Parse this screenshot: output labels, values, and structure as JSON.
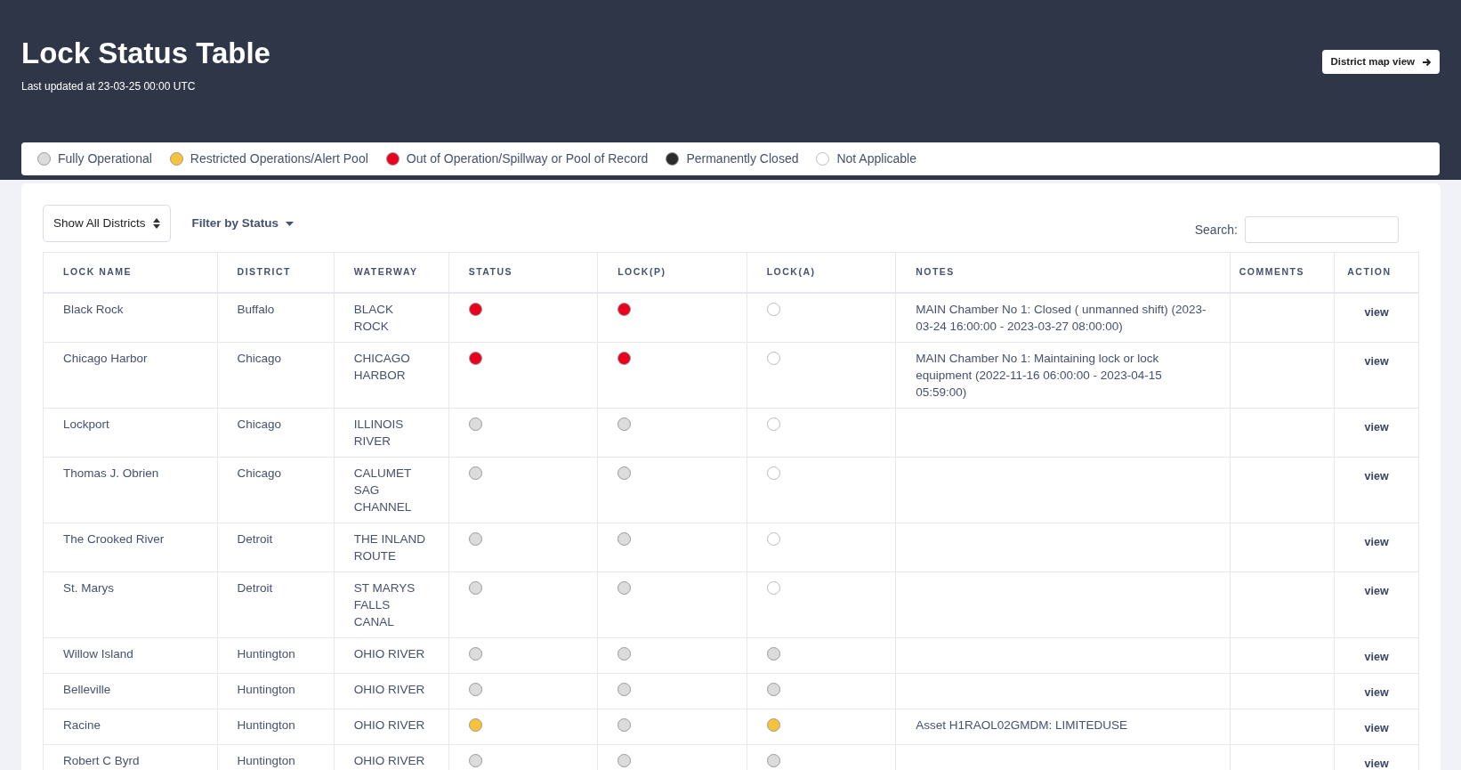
{
  "header": {
    "title": "Lock Status Table",
    "updated": "Last updated at 23-03-25 00:00 UTC",
    "map_button": "District map view"
  },
  "legend": [
    {
      "kind": "operational",
      "label": "Fully Operational",
      "color": "#dcdcdc"
    },
    {
      "kind": "restricted",
      "label": "Restricted Operations/Alert Pool",
      "color": "#f6c33a"
    },
    {
      "kind": "out",
      "label": "Out of Operation/Spillway or Pool of Record",
      "color": "#e8001c"
    },
    {
      "kind": "closed",
      "label": "Permanently Closed",
      "color": "#2b2b2b"
    },
    {
      "kind": "na",
      "label": "Not Applicable",
      "color": "#ffffff"
    }
  ],
  "controls": {
    "district_select": "Show All Districts",
    "status_filter": "Filter by Status",
    "search_label": "Search:"
  },
  "table": {
    "columns": [
      "LOCK NAME",
      "DISTRICT",
      "WATERWAY",
      "STATUS",
      "LOCK(P)",
      "LOCK(A)",
      "NOTES",
      "COMMENTS",
      "ACTION"
    ],
    "rows": [
      {
        "lock_name": "Black Rock",
        "district": "Buffalo",
        "waterway": "BLACK ROCK",
        "status": {
          "color": "#e8001c"
        },
        "lock_p": {
          "color": "#e8001c"
        },
        "lock_a": {
          "color": "#ffffff"
        },
        "notes": "MAIN Chamber No 1: Closed ( unmanned shift) (2023-03-24 16:00:00 - 2023-03-27 08:00:00)",
        "action": "view"
      },
      {
        "lock_name": "Chicago Harbor",
        "district": "Chicago",
        "waterway": "CHICAGO HARBOR",
        "status": {
          "color": "#e8001c"
        },
        "lock_p": {
          "color": "#e8001c"
        },
        "lock_a": {
          "color": "#ffffff"
        },
        "notes": "MAIN Chamber No 1: Maintaining lock or lock equipment (2022-11-16 06:00:00 - 2023-04-15 05:59:00)",
        "action": "view"
      },
      {
        "lock_name": "Lockport",
        "district": "Chicago",
        "waterway": "ILLINOIS RIVER",
        "status": {
          "color": "#dcdcdc"
        },
        "lock_p": {
          "color": "#dcdcdc"
        },
        "lock_a": {
          "color": "#ffffff"
        },
        "action": "view"
      },
      {
        "lock_name": "Thomas J. Obrien",
        "district": "Chicago",
        "waterway": "CALUMET SAG CHANNEL",
        "status": {
          "color": "#dcdcdc"
        },
        "lock_p": {
          "color": "#dcdcdc"
        },
        "lock_a": {
          "color": "#ffffff"
        },
        "action": "view"
      },
      {
        "lock_name": "The Crooked River",
        "district": "Detroit",
        "waterway": "THE INLAND ROUTE",
        "status": {
          "color": "#dcdcdc"
        },
        "lock_p": {
          "color": "#dcdcdc"
        },
        "lock_a": {
          "color": "#ffffff"
        },
        "action": "view"
      },
      {
        "lock_name": "St. Marys",
        "district": "Detroit",
        "waterway": "ST MARYS FALLS CANAL",
        "status": {
          "color": "#dcdcdc"
        },
        "lock_p": {
          "color": "#dcdcdc"
        },
        "lock_a": {
          "color": "#ffffff"
        },
        "action": "view"
      },
      {
        "lock_name": "Willow Island",
        "district": "Huntington",
        "waterway": "OHIO RIVER",
        "status": {
          "color": "#dcdcdc"
        },
        "lock_p": {
          "color": "#dcdcdc"
        },
        "lock_a": {
          "color": "#dcdcdc"
        },
        "action": "view"
      },
      {
        "lock_name": "Belleville",
        "district": "Huntington",
        "waterway": "OHIO RIVER",
        "status": {
          "color": "#dcdcdc"
        },
        "lock_p": {
          "color": "#dcdcdc"
        },
        "lock_a": {
          "color": "#dcdcdc"
        },
        "action": "view"
      },
      {
        "lock_name": "Racine",
        "district": "Huntington",
        "waterway": "OHIO RIVER",
        "status": {
          "color": "#f6c33a"
        },
        "lock_p": {
          "color": "#dcdcdc"
        },
        "lock_a": {
          "color": "#f6c33a"
        },
        "notes": "Asset H1RAOL02GMDM: LIMITEDUSE",
        "action": "view"
      },
      {
        "lock_name": "Robert C Byrd",
        "district": "Huntington",
        "waterway": "OHIO RIVER",
        "status": {
          "color": "#dcdcdc"
        },
        "lock_p": {
          "color": "#dcdcdc"
        },
        "lock_a": {
          "color": "#dcdcdc"
        },
        "action": "view"
      }
    ]
  }
}
